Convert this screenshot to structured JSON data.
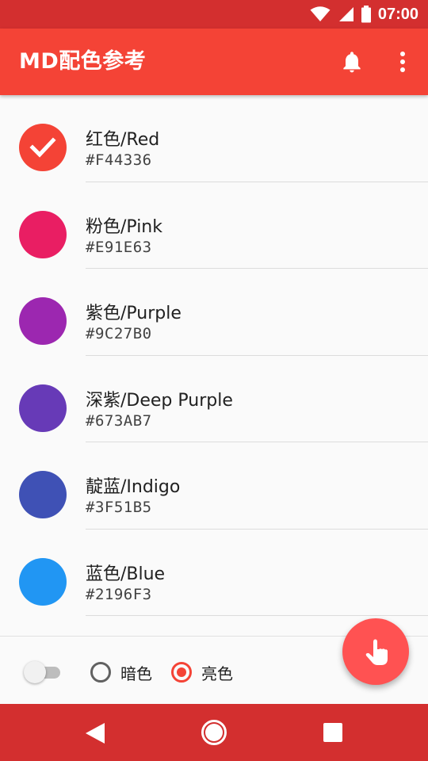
{
  "status_bar": {
    "time": "07:00"
  },
  "app_bar": {
    "title": "MD配色参考"
  },
  "colors": [
    {
      "name": "红色/Red",
      "hex": "#F44336",
      "color": "#F44336",
      "checked": true
    },
    {
      "name": "粉色/Pink",
      "hex": "#E91E63",
      "color": "#E91E63",
      "checked": false
    },
    {
      "name": "紫色/Purple",
      "hex": "#9C27B0",
      "color": "#9C27B0",
      "checked": false
    },
    {
      "name": "深紫/Deep Purple",
      "hex": "#673AB7",
      "color": "#673AB7",
      "checked": false
    },
    {
      "name": "靛蓝/Indigo",
      "hex": "#3F51B5",
      "color": "#3F51B5",
      "checked": false
    },
    {
      "name": "蓝色/Blue",
      "hex": "#2196F3",
      "color": "#2196F3",
      "checked": false
    }
  ],
  "controls": {
    "toggle_on": false,
    "theme_options": [
      {
        "label": "暗色",
        "selected": false
      },
      {
        "label": "亮色",
        "selected": true
      }
    ]
  },
  "theme": {
    "primary": "#F44336",
    "primary_dark": "#D32F2F",
    "accent": "#FF5252"
  },
  "icons": {
    "app_bar": [
      "bell-icon",
      "more-vert-icon"
    ],
    "fab": "touch-icon",
    "nav": [
      "back-icon",
      "home-icon",
      "recents-icon"
    ],
    "status": [
      "wifi-icon",
      "signal-icon",
      "battery-icon"
    ]
  }
}
